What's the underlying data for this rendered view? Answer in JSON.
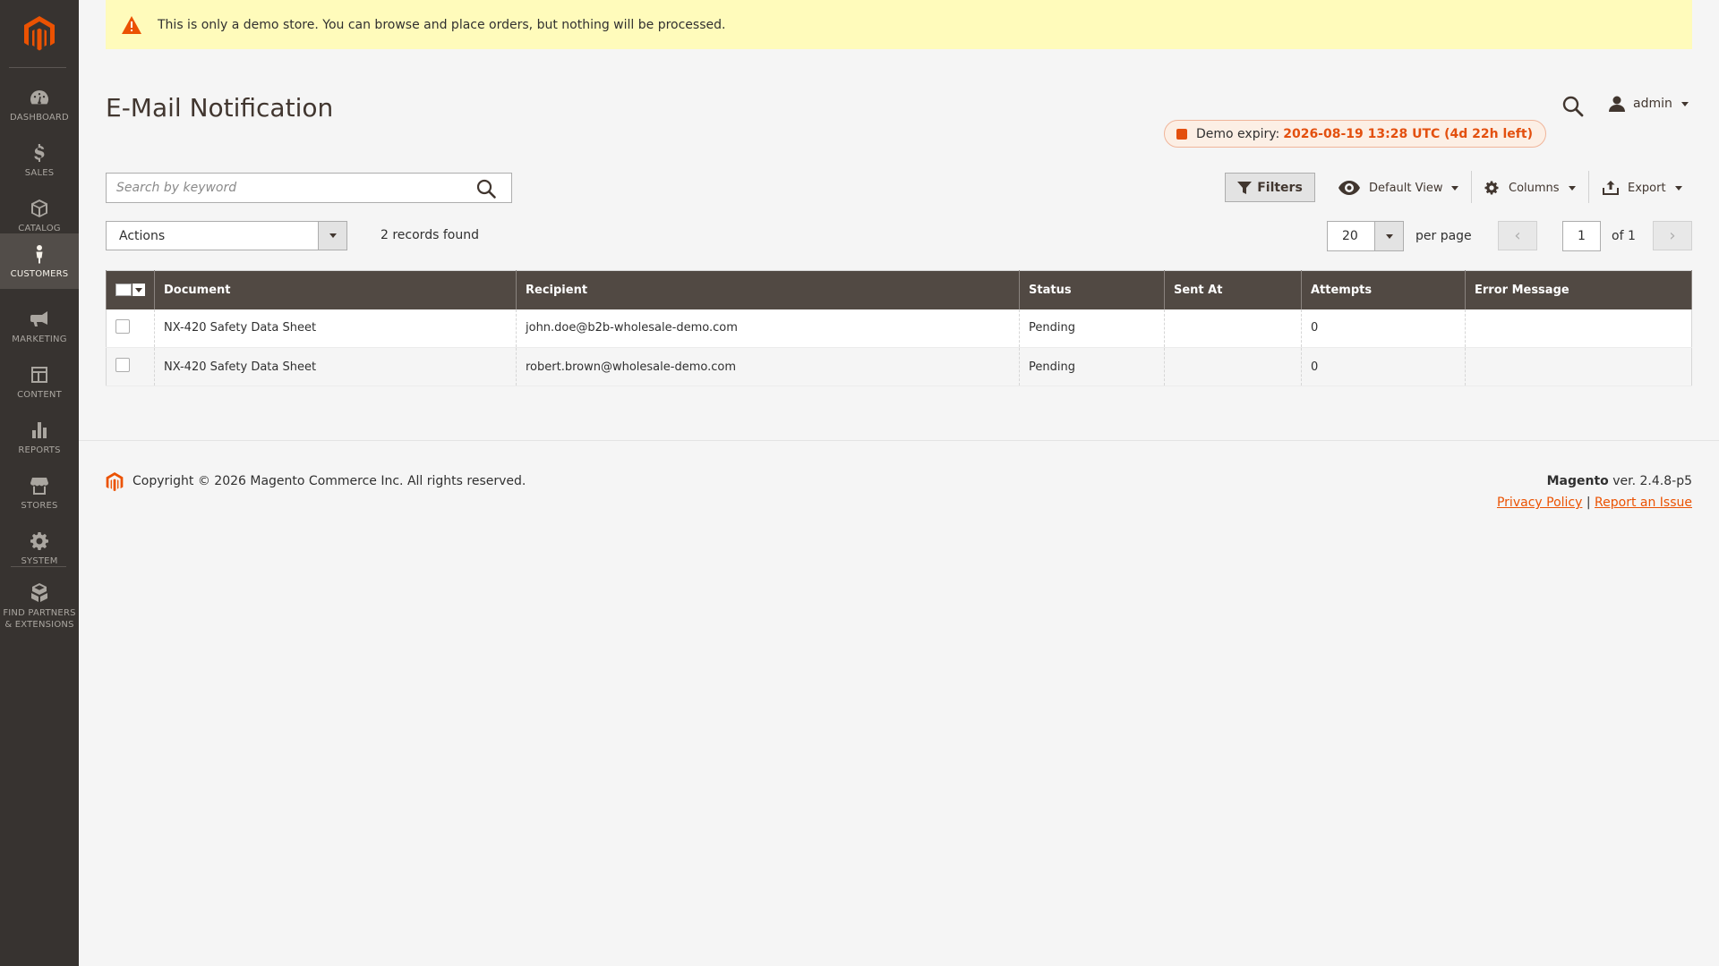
{
  "sidebar": {
    "items": [
      {
        "label": "Dashboard",
        "icon": "dashboard-icon"
      },
      {
        "label": "Sales",
        "icon": "dollar-icon"
      },
      {
        "label": "Catalog",
        "icon": "cube-icon"
      },
      {
        "label": "Customers",
        "icon": "person-icon"
      },
      {
        "label": "Marketing",
        "icon": "megaphone-icon"
      },
      {
        "label": "Content",
        "icon": "layout-icon"
      },
      {
        "label": "Reports",
        "icon": "bar-chart-icon"
      },
      {
        "label": "Stores",
        "icon": "storefront-icon"
      },
      {
        "label": "System",
        "icon": "gear-icon"
      },
      {
        "label": "Find Partners & Extensions",
        "icon": "boxes-icon"
      }
    ]
  },
  "notice": {
    "text": "This is only a demo store. You can browse and place orders, but nothing will be processed."
  },
  "header": {
    "title": "E-Mail Notification",
    "user": "admin",
    "demo_label": "Demo expiry:",
    "demo_value": "2026-08-19 13:28 UTC (4d 22h left)"
  },
  "toolbar": {
    "search_placeholder": "Search by keyword",
    "filters_label": "Filters",
    "view_label": "Default View",
    "columns_label": "Columns",
    "export_label": "Export"
  },
  "actions": {
    "label": "Actions",
    "records": "2 records found"
  },
  "pager": {
    "per_page_value": "20",
    "per_page_label": "per page",
    "page_value": "1",
    "of_label": "of 1"
  },
  "grid": {
    "columns": [
      "Document",
      "Recipient",
      "Status",
      "Sent At",
      "Attempts",
      "Error Message"
    ],
    "rows": [
      {
        "document": "NX-420 Safety Data Sheet",
        "recipient": "john.doe@b2b-wholesale-demo.com",
        "status": "Pending",
        "sent_at": "",
        "attempts": "0",
        "error": ""
      },
      {
        "document": "NX-420 Safety Data Sheet",
        "recipient": "robert.brown@wholesale-demo.com",
        "status": "Pending",
        "sent_at": "",
        "attempts": "0",
        "error": ""
      }
    ]
  },
  "footer": {
    "copyright": "Copyright © 2026 Magento Commerce Inc. All rights reserved.",
    "brand": "Magento",
    "version": "ver. 2.4.8-p5",
    "privacy": "Privacy Policy",
    "separator": "|",
    "report": "Report an Issue"
  },
  "colors": {
    "accent": "#eb5202",
    "sidebar": "#373330",
    "header_row": "#514943",
    "notice": "#fffbbb"
  }
}
